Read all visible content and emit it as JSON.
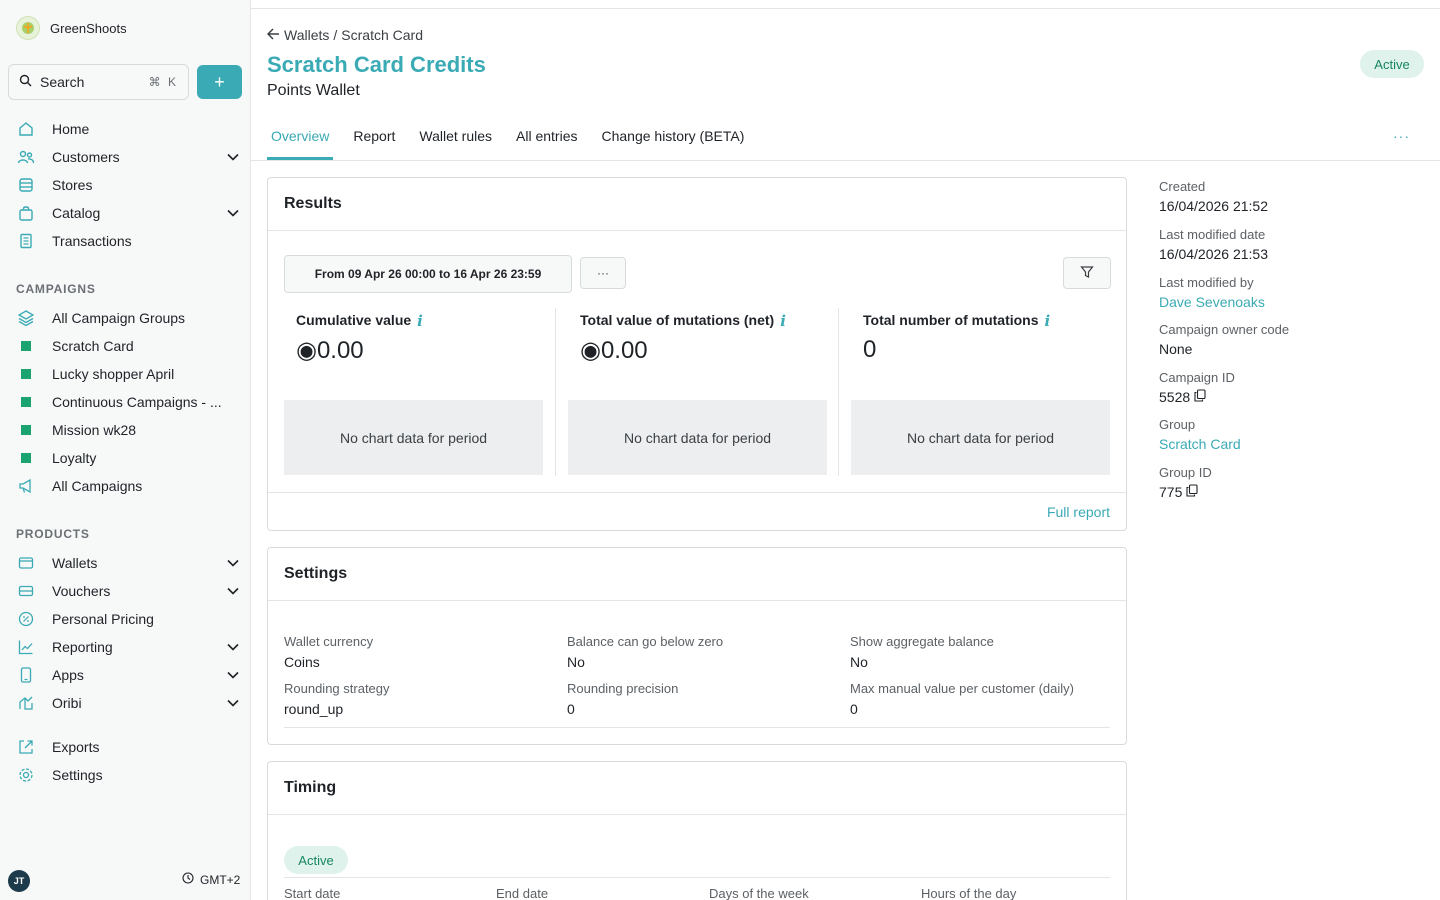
{
  "app": {
    "name": "GreenShoots"
  },
  "search": {
    "label": "Search",
    "shortcut": "⌘ K"
  },
  "add_button": "+",
  "nav": {
    "home": "Home",
    "customers": "Customers",
    "stores": "Stores",
    "catalog": "Catalog",
    "transactions": "Transactions"
  },
  "campaigns": {
    "title": "CAMPAIGNS",
    "items": [
      "All Campaign Groups",
      "Scratch Card",
      "Lucky shopper April",
      "Continuous Campaigns - ...",
      "Mission wk28",
      "Loyalty",
      "All Campaigns"
    ]
  },
  "products": {
    "title": "PRODUCTS",
    "items": [
      "Wallets",
      "Vouchers",
      "Personal Pricing",
      "Reporting",
      "Apps",
      "Oribi"
    ]
  },
  "bottom_nav": {
    "exports": "Exports",
    "settings": "Settings"
  },
  "user": {
    "initials": "JT",
    "timezone": "GMT+2"
  },
  "breadcrumb": {
    "parent": "Wallets",
    "sep": "/",
    "current": "Scratch Card"
  },
  "page": {
    "title": "Scratch Card Credits",
    "subtitle": "Points Wallet",
    "status": "Active"
  },
  "tabs": [
    "Overview",
    "Report",
    "Wallet rules",
    "All entries",
    "Change history (BETA)"
  ],
  "tabs_more": "···",
  "results": {
    "title": "Results",
    "range": "From 09 Apr 26 00:00 to 16 Apr 26 23:59",
    "more": "···",
    "metrics": [
      {
        "title": "Cumulative value",
        "info": "i",
        "value": "◉0.00",
        "empty": "No chart data for period"
      },
      {
        "title": "Total value of mutations (net)",
        "info": "i",
        "value": "◉0.00",
        "empty": "No chart data for period"
      },
      {
        "title": "Total number of mutations",
        "info": "i",
        "value": "0",
        "empty": "No chart data for period"
      }
    ],
    "full_report": "Full report"
  },
  "settings": {
    "title": "Settings",
    "fields": [
      {
        "label": "Wallet currency",
        "value": "Coins"
      },
      {
        "label": "Balance can go below zero",
        "value": "No"
      },
      {
        "label": "Show aggregate balance",
        "value": "No"
      },
      {
        "label": "Rounding strategy",
        "value": "round_up"
      },
      {
        "label": "Rounding precision",
        "value": "0"
      },
      {
        "label": "Max manual value per customer (daily)",
        "value": "0"
      }
    ]
  },
  "timing": {
    "title": "Timing",
    "status": "Active",
    "columns": [
      "Start date",
      "End date",
      "Days of the week",
      "Hours of the day"
    ]
  },
  "meta": {
    "created_label": "Created",
    "created": "16/04/2026 21:52",
    "modified_label": "Last modified date",
    "modified": "16/04/2026 21:53",
    "modified_by_label": "Last modified by",
    "modified_by": "Dave Sevenoaks",
    "owner_label": "Campaign owner code",
    "owner": "None",
    "campaign_id_label": "Campaign ID",
    "campaign_id": "5528",
    "group_label": "Group",
    "group": "Scratch Card",
    "group_id_label": "Group ID",
    "group_id": "775"
  },
  "colors": {
    "accent": "#3aaab4",
    "success": "#17865e",
    "campaign_square": "#1aa36f"
  }
}
